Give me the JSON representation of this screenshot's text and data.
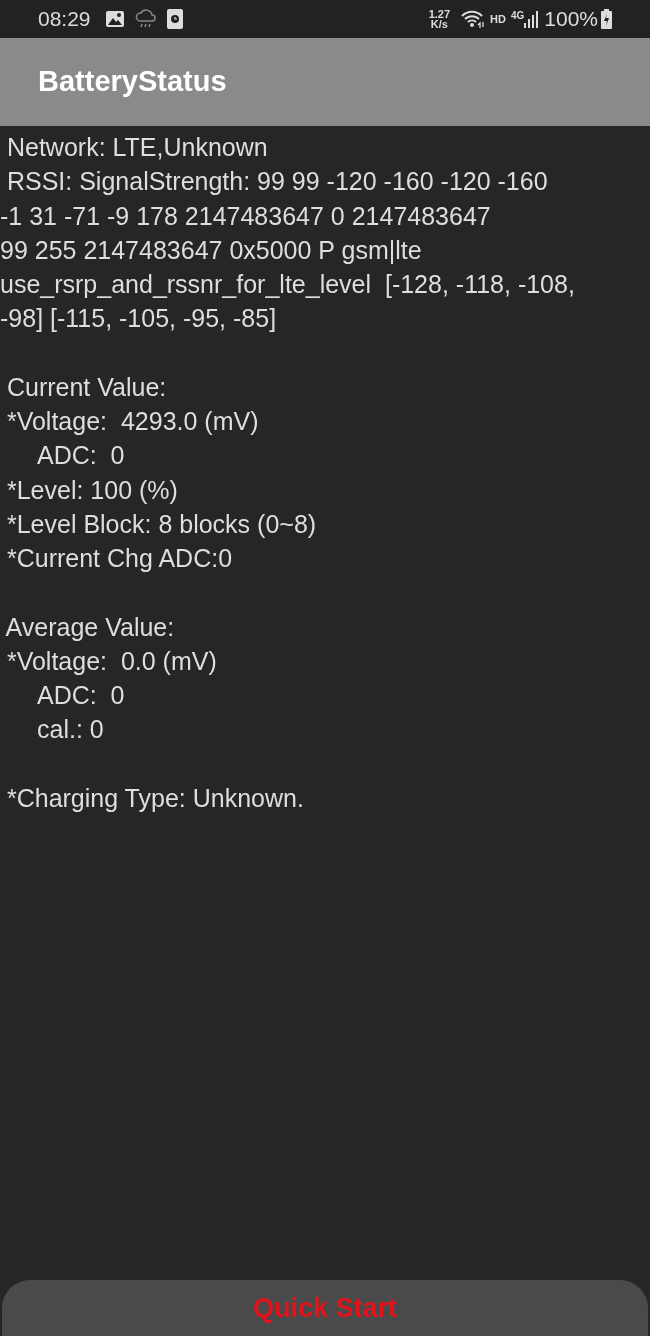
{
  "status_bar": {
    "time": "08:29",
    "speed_value": "1.27",
    "speed_unit": "K/s",
    "hd": "HD",
    "network": "4G",
    "battery": "100%"
  },
  "app_bar": {
    "title": "BatteryStatus"
  },
  "sections": [
    {
      "lines": [
        {
          "kind": "line",
          "text": " Network: LTE,Unknown"
        },
        {
          "kind": "line",
          "text": " RSSI: SignalStrength: 99 99 -120 -160 -120 -160"
        },
        {
          "kind": "line",
          "text": "-1 31 -71 -9 178 2147483647 0 2147483647"
        },
        {
          "kind": "line",
          "text": "99 255 2147483647 0x5000 P gsm|lte"
        },
        {
          "kind": "line",
          "text": "use_rsrp_and_rssnr_for_lte_level  [-128, -118, -108,"
        },
        {
          "kind": "line",
          "text": "-98] [-115, -105, -95, -85]"
        }
      ]
    },
    {
      "lines": [
        {
          "kind": "line",
          "text": " Current Value:"
        },
        {
          "kind": "line",
          "text": " *Voltage:  4293.0 (mV)"
        },
        {
          "kind": "indent",
          "text": "ADC:  0"
        },
        {
          "kind": "line",
          "text": " *Level: 100 (%)"
        },
        {
          "kind": "line",
          "text": " *Level Block: 8 blocks (0~8)"
        },
        {
          "kind": "line",
          "text": " *Current Chg ADC:0"
        }
      ]
    },
    {
      "lines": [
        {
          "kind": "line",
          "text": " Average Value:"
        },
        {
          "kind": "line",
          "text": " *Voltage:  0.0 (mV)"
        },
        {
          "kind": "indent",
          "text": "ADC:  0"
        },
        {
          "kind": "indent",
          "text": "cal.: 0"
        }
      ]
    },
    {
      "lines": [
        {
          "kind": "line",
          "text": " *Charging Type: Unknown."
        }
      ]
    }
  ],
  "button": {
    "label": "Quick Start"
  }
}
